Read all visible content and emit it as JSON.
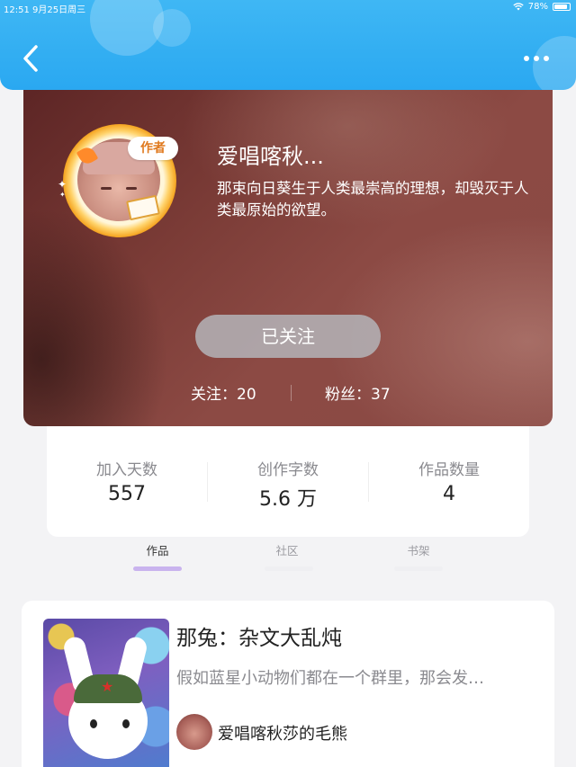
{
  "status_bar": {
    "time": "12:51",
    "date": "9月25日周三",
    "battery": "78%"
  },
  "profile": {
    "name": "爱唱喀秋...",
    "bio": "那束向日葵生于人类最崇高的理想，却毁灭于人类最原始的欲望。",
    "badge": "作者",
    "follow_button": "已关注",
    "following": "关注：20",
    "fans": "粉丝：37"
  },
  "stats": [
    {
      "label": "加入天数",
      "value": "557"
    },
    {
      "label": "创作字数",
      "value": "5.6 万"
    },
    {
      "label": "作品数量",
      "value": "4"
    }
  ],
  "tabs": [
    {
      "label": "作品",
      "active": true
    },
    {
      "label": "社区",
      "active": false
    },
    {
      "label": "书架",
      "active": false
    }
  ],
  "work": {
    "title": "那兔：杂文大乱炖",
    "desc": "假如蓝星小动物们都在一个群里，那会发…",
    "author": "爱唱喀秋莎的毛熊"
  },
  "colors": {
    "header": "#2aa8f1",
    "profile_bg": "#7a3b36",
    "tab_active_indicator": "#c9b3ee"
  },
  "icons": [
    "back-icon",
    "more-icon",
    "wifi-icon",
    "battery-icon"
  ]
}
